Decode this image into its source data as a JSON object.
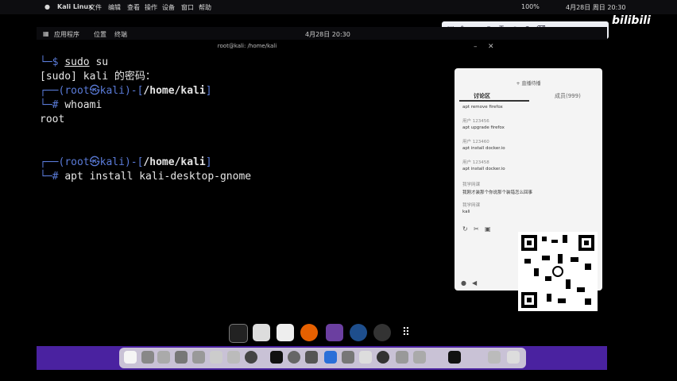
{
  "mac_menubar": {
    "app": "Kali Linux",
    "menus": [
      "文件",
      "编辑",
      "查看",
      "操作",
      "设备",
      "窗口",
      "帮助"
    ],
    "battery": "100%",
    "datetime": "4月28日 周日  20:30"
  },
  "kali_panel": {
    "apps": "应用程序",
    "places": "位置",
    "terminal": "终端",
    "clock": "4月28日  20:30"
  },
  "terminal": {
    "title": "root@kali: /home/kali",
    "l1_prefix": "└─$ ",
    "l1_cmd": "sudo",
    "l1_arg": " su",
    "l2": "[sudo] kali 的密码：",
    "l3_a": "┌──(",
    "l3_user": "root㉿kali",
    "l3_b": ")-[",
    "l3_dir": "/home/kali",
    "l3_c": "]",
    "l4_prefix": "└─# ",
    "l4_cmd": "whoami",
    "l5": "root",
    "l6_a": "┌──(",
    "l6_user": "root㉿kali",
    "l6_b": ")-[",
    "l6_dir": "/home/kali",
    "l6_c": "]",
    "l7_prefix": "└─# ",
    "l7_cmd": "apt install kali-desktop-gnome"
  },
  "chat": {
    "header": "+ 直播待播",
    "tab_active": "讨论区",
    "tab_other": "成员(999)",
    "messages": [
      {
        "name": "",
        "text": "apt remove firefox"
      },
      {
        "name": "用户 123456",
        "text": "apt upgrade firefox"
      },
      {
        "name": "用户 123460",
        "text": "apt install docker.io"
      },
      {
        "name": "用户 123458",
        "text": "apt install docker.io"
      },
      {
        "name": "我学网课",
        "text": "我刚才装那个你说那个装错怎么回事"
      },
      {
        "name": "我学网课",
        "text": "kali"
      }
    ]
  },
  "brand": "bilibili",
  "colors": {
    "terminal_bg": "#000000",
    "prompt_blue": "#5a7bd8",
    "dock_purple": "#4a22a0"
  }
}
